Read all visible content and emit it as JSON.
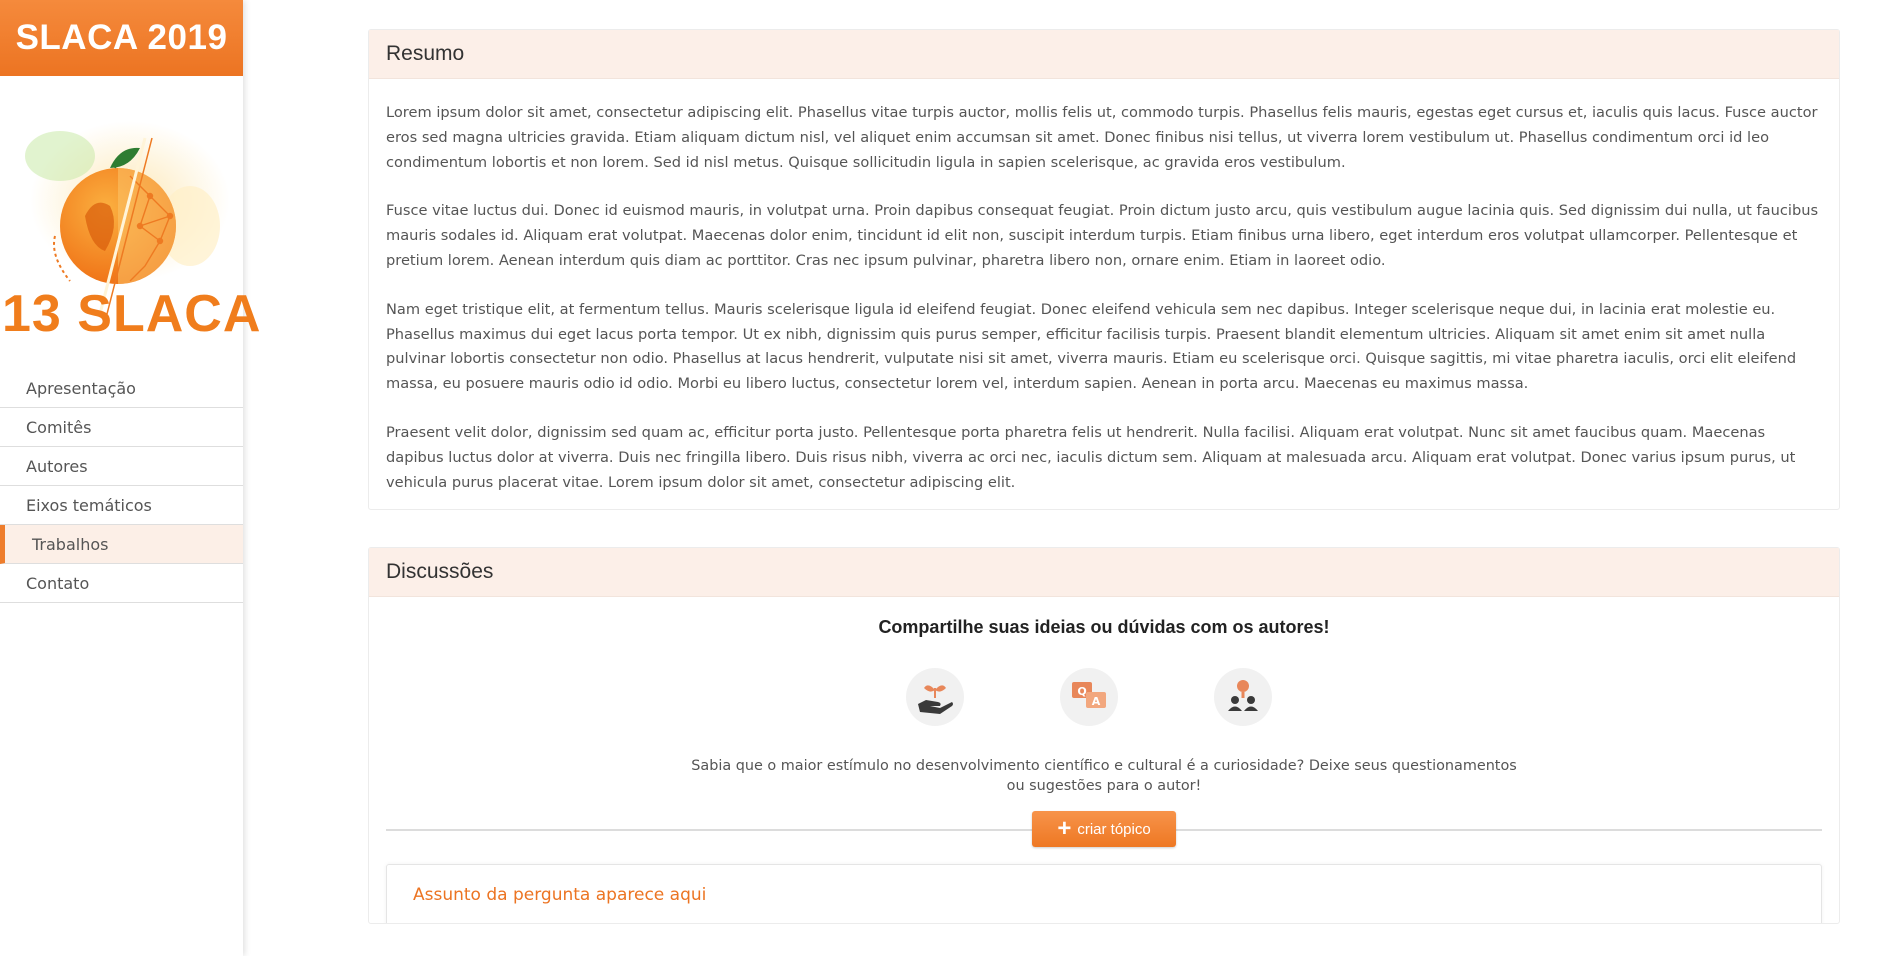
{
  "sidebar": {
    "brand": "SLACA 2019",
    "logo_text": "13 SLACA",
    "items": [
      {
        "label": "Apresentação"
      },
      {
        "label": "Comitês"
      },
      {
        "label": "Autores"
      },
      {
        "label": "Eixos temáticos"
      },
      {
        "label": "Trabalhos",
        "active": true
      },
      {
        "label": "Contato"
      }
    ]
  },
  "resumo": {
    "title": "Resumo",
    "paragraphs": [
      "Lorem ipsum dolor sit amet, consectetur adipiscing elit. Phasellus vitae turpis auctor, mollis felis ut, commodo turpis. Phasellus felis mauris, egestas eget cursus et, iaculis quis lacus. Fusce auctor eros sed magna ultricies gravida. Etiam aliquam dictum nisl, vel aliquet enim accumsan sit amet. Donec finibus nisi tellus, ut viverra lorem vestibulum ut. Phasellus condimentum orci id leo condimentum lobortis et non lorem. Sed id nisl metus. Quisque sollicitudin ligula in sapien scelerisque, ac gravida eros vestibulum.",
      "Fusce vitae luctus dui. Donec id euismod mauris, in volutpat urna. Proin dapibus consequat feugiat. Proin dictum justo arcu, quis vestibulum augue lacinia quis. Sed dignissim dui nulla, ut faucibus mauris sodales id. Aliquam erat volutpat. Maecenas dolor enim, tincidunt id elit non, suscipit interdum turpis. Etiam finibus urna libero, eget interdum eros volutpat ullamcorper. Pellentesque et pretium lorem. Aenean interdum quis diam ac porttitor. Cras nec ipsum pulvinar, pharetra libero non, ornare enim. Etiam in laoreet odio.",
      "Nam eget tristique elit, at fermentum tellus. Mauris scelerisque ligula id eleifend feugiat. Donec eleifend vehicula sem nec dapibus. Integer scelerisque neque dui, in lacinia erat molestie eu. Phasellus maximus dui eget lacus porta tempor. Ut ex nibh, dignissim quis purus semper, efficitur facilisis turpis. Praesent blandit elementum ultricies. Aliquam sit amet enim sit amet nulla pulvinar lobortis consectetur non odio. Phasellus at lacus hendrerit, vulputate nisi sit amet, viverra mauris. Etiam eu scelerisque orci. Quisque sagittis, mi vitae pharetra iaculis, orci elit eleifend massa, eu posuere mauris odio id odio. Morbi eu libero luctus, consectetur lorem vel, interdum sapien. Aenean in porta arcu. Maecenas eu maximus massa.",
      "Praesent velit dolor, dignissim sed quam ac, efficitur porta justo. Pellentesque porta pharetra felis ut hendrerit. Nulla facilisi. Aliquam erat volutpat. Nunc sit amet faucibus quam. Maecenas dapibus luctus dolor at viverra. Duis nec fringilla libero. Duis risus nibh, viverra ac orci nec, iaculis dictum sem. Aliquam at malesuada arcu. Aliquam erat volutpat. Donec varius ipsum purus, ut vehicula purus placerat vitae. Lorem ipsum dolor sit amet, consectetur adipiscing elit."
    ]
  },
  "discussoes": {
    "title": "Discussões",
    "heading": "Compartilhe suas ideias ou dúvidas com os autores!",
    "icons": [
      "hand-plant-icon",
      "qa-chat-icon",
      "people-icon"
    ],
    "text": "Sabia que o maior estímulo no desenvolvimento científico e cultural é a curiosidade? Deixe seus questionamentos ou sugestões para o autor!",
    "button_label": "criar tópico",
    "topic_title": "Assunto da pergunta aparece aqui"
  },
  "colors": {
    "accent": "#ee7823",
    "header_bg": "#fcefe8"
  }
}
